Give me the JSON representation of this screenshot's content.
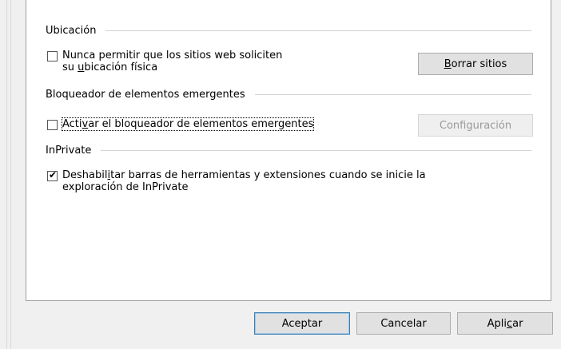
{
  "location": {
    "heading": "Ubicación",
    "checkbox_line1": "Nunca permitir que los sitios web soliciten",
    "checkbox_line2_pre": "su ",
    "checkbox_line2_key": "u",
    "checkbox_line2_post": "bicación física",
    "checked": false,
    "button_key": "B",
    "button_rest": "orrar sitios"
  },
  "popup": {
    "heading": "Bloqueador de elementos emergentes",
    "checkbox_pre": "Acti",
    "checkbox_key": "v",
    "checkbox_post": "ar el bloqueador de elementos emergentes",
    "checked": false,
    "button_pre": "Confi",
    "button_key": "g",
    "button_post": "uración",
    "button_enabled": false
  },
  "inprivate": {
    "heading": "InPrivate",
    "checkbox_pre": "Deshabil",
    "checkbox_key": "i",
    "checkbox_post": "tar barras de herramientas y extensiones cuando se inicie la",
    "checkbox_line2": "exploración de InPrivate",
    "checked": true
  },
  "footer": {
    "ok_label": "Aceptar",
    "cancel_label": "Cancelar",
    "apply_pre": "Apli",
    "apply_key": "c",
    "apply_post": "ar"
  },
  "icons": {
    "checkmark": "✔"
  },
  "colors": {
    "focus_border": "#3c7fb1",
    "panel_bg": "#ffffff",
    "window_bg": "#f0f0f0"
  }
}
